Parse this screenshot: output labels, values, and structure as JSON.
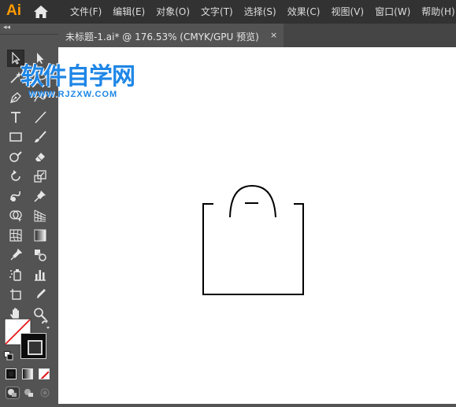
{
  "app": {
    "logo": "Ai"
  },
  "menu": [
    "文件(F)",
    "编辑(E)",
    "对象(O)",
    "文字(T)",
    "选择(S)",
    "效果(C)",
    "视图(V)",
    "窗口(W)",
    "帮助(H)"
  ],
  "document_tab": {
    "title": "未标题-1.ai* @ 176.53% (CMYK/GPU 预览)",
    "close": "×"
  },
  "toolbar": {
    "collapse": "◂◂"
  },
  "tools": [
    "selection",
    "direct-selection",
    "magic-wand",
    "lasso",
    "pen",
    "curvature",
    "type",
    "line-segment",
    "rectangle",
    "paintbrush",
    "shaper",
    "eraser",
    "rotate",
    "scale",
    "warp",
    "free-transform",
    "shape-builder",
    "perspective-grid",
    "mesh",
    "gradient",
    "eyedropper",
    "blend",
    "symbol-sprayer",
    "column-graph",
    "artboard",
    "slice",
    "hand",
    "zoom"
  ],
  "watermark": {
    "title": "软件自学网",
    "url": "WWW.RJZXW.COM"
  },
  "colors": {
    "menubar": "#323232",
    "panel": "#535353",
    "canvas": "#ffffff",
    "logo": "#ff9a00",
    "watermark": "#1e86e6",
    "none_slash": "#e01010"
  }
}
